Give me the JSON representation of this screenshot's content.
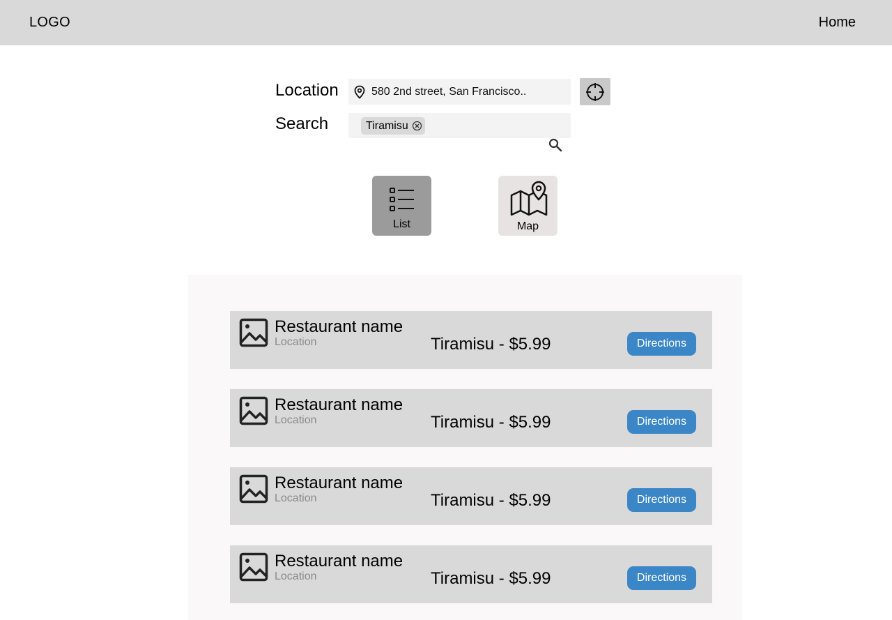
{
  "header": {
    "logo": "LOGO",
    "nav_home": "Home"
  },
  "search_form": {
    "location_label": "Location",
    "location_value": "580 2nd street, San Francisco..",
    "search_label": "Search",
    "search_tag": "Tiramisu"
  },
  "view_toggle": {
    "list_label": "List",
    "map_label": "Map",
    "selected": "List"
  },
  "results": [
    {
      "name": "Restaurant name",
      "location": "Location",
      "item": "Tiramisu - $5.99",
      "action": "Directions"
    },
    {
      "name": "Restaurant name",
      "location": "Location",
      "item": "Tiramisu - $5.99",
      "action": "Directions"
    },
    {
      "name": "Restaurant name",
      "location": "Location",
      "item": "Tiramisu - $5.99",
      "action": "Directions"
    },
    {
      "name": "Restaurant name",
      "location": "Location",
      "item": "Tiramisu - $5.99",
      "action": "Directions"
    }
  ],
  "icons": {
    "location_pin": "map-pin-icon",
    "locate": "crosshair-icon",
    "chip_remove": "remove-tag-icon",
    "search": "magnifier-icon",
    "list_view": "list-icon",
    "map_view": "map-icon",
    "result_thumbnail": "image-placeholder-icon"
  },
  "colors": {
    "header_bg": "#d9d9d9",
    "card_bg": "#d9d9d9",
    "panel_bg": "#faf8f8",
    "primary_button": "#3b86c6",
    "list_selected_bg": "#9b9b9b",
    "map_button_bg": "#e8e3e3"
  }
}
